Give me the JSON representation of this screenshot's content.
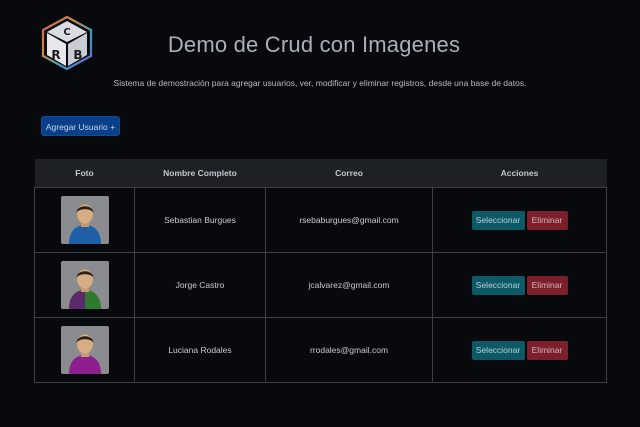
{
  "header": {
    "title": "Demo de Crud con Imagenes",
    "subtitle": "Sistema de demostración para agregar usuarios, ver, modificar y eliminar registros, desde una base de datos.",
    "logo_icon": "crb-cube-logo-icon"
  },
  "toolbar": {
    "add_label": "Agregar Usuario +",
    "add_color": "#0a3f8a"
  },
  "table": {
    "columns": [
      "Foto",
      "Nombre Completo",
      "Correo",
      "Acciones"
    ],
    "rows": [
      {
        "name": "Sebastian Burgues",
        "email": "rsebaburgues@gmail.com",
        "avatar_color": "#1f5fa8",
        "avatar_icon": "user-avatar-icon"
      },
      {
        "name": "Jorge Castro",
        "email": "jcalvarez@gmail.com",
        "avatar_color": "#2f7a2f",
        "avatar_icon": "user-avatar-icon"
      },
      {
        "name": "Luciana Rodales",
        "email": "rrodales@gmail.com",
        "avatar_color": "#8e1f8e",
        "avatar_icon": "user-avatar-icon"
      }
    ],
    "select_label": "Seleccionar",
    "delete_label": "Eliminar",
    "select_color": "#0d5a66",
    "delete_color": "#7b1f2a"
  }
}
